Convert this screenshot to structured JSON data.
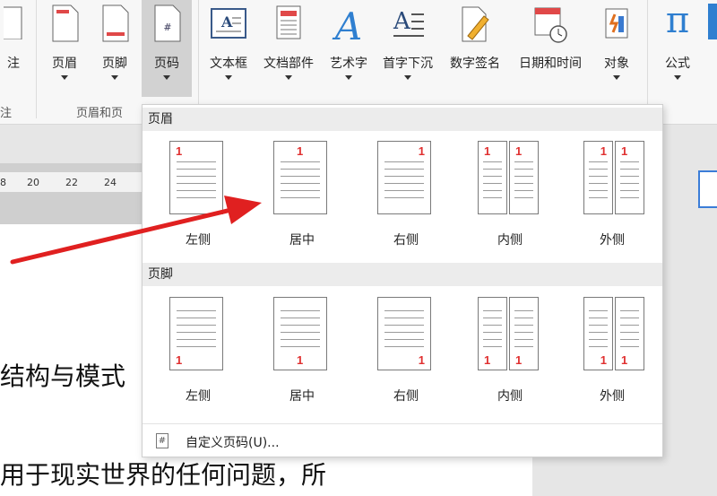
{
  "ribbon": {
    "buttons": [
      {
        "label": "注",
        "arrow": false
      },
      {
        "label": "页眉",
        "arrow": true
      },
      {
        "label": "页脚",
        "arrow": true
      },
      {
        "label": "页码",
        "arrow": true
      },
      {
        "label": "文本框",
        "arrow": true
      },
      {
        "label": "文档部件",
        "arrow": true
      },
      {
        "label": "艺术字",
        "arrow": true
      },
      {
        "label": "首字下沉",
        "arrow": true
      },
      {
        "label": "数字签名",
        "arrow": false
      },
      {
        "label": "日期和时间",
        "arrow": false
      },
      {
        "label": "对象",
        "arrow": true
      },
      {
        "label": "公式",
        "arrow": true
      }
    ],
    "group_labels": {
      "left": "注",
      "header_footer": "页眉和页"
    },
    "formula_glyph": "π"
  },
  "ruler": {
    "ticks": [
      "8",
      "20",
      "22",
      "24"
    ]
  },
  "document": {
    "line1": "结构与模式",
    "line2": "用于现实世界的任何问题，所"
  },
  "dropdown": {
    "header_section": {
      "title": "页眉",
      "options": [
        "左侧",
        "居中",
        "右侧",
        "内侧",
        "外侧"
      ]
    },
    "footer_section": {
      "title": "页脚",
      "options": [
        "左侧",
        "居中",
        "右侧",
        "内侧",
        "外侧"
      ]
    },
    "page_number_glyph": "1",
    "custom_label": "自定义页码(U)..."
  },
  "colors": {
    "accent_red": "#e03030",
    "arrow_red": "#e02020",
    "focus_blue": "#3b7dd8"
  }
}
